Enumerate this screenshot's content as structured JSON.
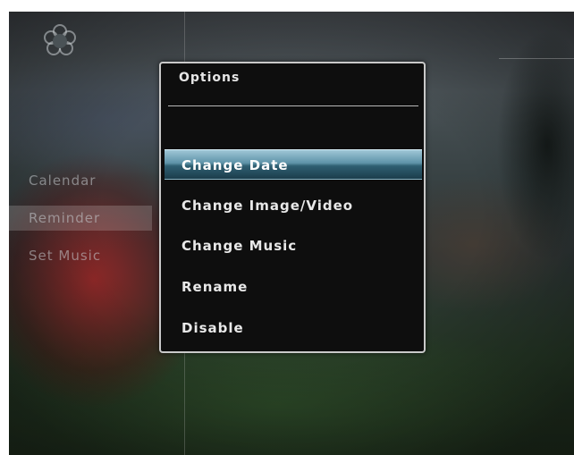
{
  "sidebar": {
    "items": [
      {
        "label": "Calendar"
      },
      {
        "label": "Reminder"
      },
      {
        "label": "Set Music"
      }
    ]
  },
  "dialog": {
    "title": "Options",
    "options": [
      {
        "label": "Change Date",
        "selected": true
      },
      {
        "label": "Change Image/Video",
        "selected": false
      },
      {
        "label": "Change Music",
        "selected": false
      },
      {
        "label": "Rename",
        "selected": false
      },
      {
        "label": "Disable",
        "selected": false
      }
    ]
  },
  "colors": {
    "highlight": "#5e93a8",
    "dialog_background": "#0e0e0e",
    "dialog_border": "#c9c9c9"
  },
  "icons": {
    "corner": "flower-icon"
  }
}
